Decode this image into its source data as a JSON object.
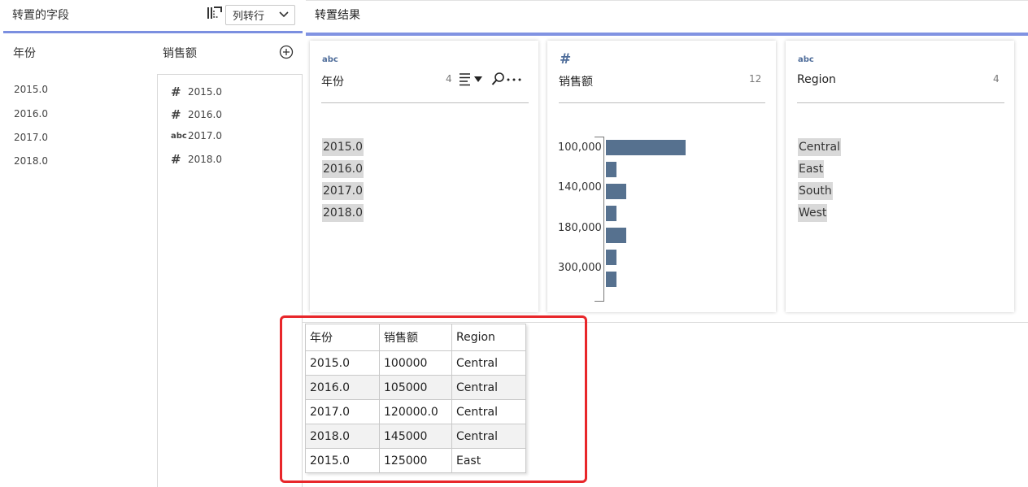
{
  "header": {
    "left_title": "转置的字段",
    "mode_select": "列转行",
    "right_title": "转置结果"
  },
  "left_panel": {
    "year_header": "年份",
    "sales_header": "销售额",
    "years": [
      "2015.0",
      "2016.0",
      "2017.0",
      "2018.0"
    ],
    "sales_items": [
      {
        "type": "hash",
        "label": "2015.0"
      },
      {
        "type": "hash",
        "label": "2016.0"
      },
      {
        "type": "abc",
        "label": "2017.0"
      },
      {
        "type": "hash",
        "label": "2018.0"
      }
    ]
  },
  "cards": [
    {
      "type": "abc",
      "name": "年份",
      "count": "4",
      "values": [
        "2015.0",
        "2016.0",
        "2017.0",
        "2018.0"
      ]
    },
    {
      "type": "#",
      "name": "销售额",
      "count": "12",
      "histogram": {
        "tick_labels": [
          "100,000",
          "140,000",
          "180,000",
          "300,000"
        ],
        "bars": [
          1.0,
          0.13,
          0.26,
          0.13,
          0.26,
          0.13,
          0.13
        ]
      }
    },
    {
      "type": "abc",
      "name": "Region",
      "count": "4",
      "values": [
        "Central",
        "East",
        "South",
        "West"
      ]
    }
  ],
  "table": {
    "headers": [
      "年份",
      "销售额",
      "Region"
    ],
    "rows": [
      [
        "2015.0",
        "100000",
        "Central"
      ],
      [
        "2016.0",
        "105000",
        "Central"
      ],
      [
        "2017.0",
        "120000.0",
        "Central"
      ],
      [
        "2018.0",
        "145000",
        "Central"
      ],
      [
        "2015.0",
        "125000",
        "East"
      ]
    ]
  },
  "colors": {
    "accent": "#7b8fe0",
    "bar": "#56718f",
    "type_icon": "#4f6d9a",
    "highlight": "#e8262a"
  },
  "icons": [
    "pivot-icon",
    "chevron-down-icon",
    "add-circle-icon",
    "hash-icon",
    "abc-icon",
    "sort-icon",
    "caret-down-icon",
    "search-icon",
    "more-icon"
  ]
}
